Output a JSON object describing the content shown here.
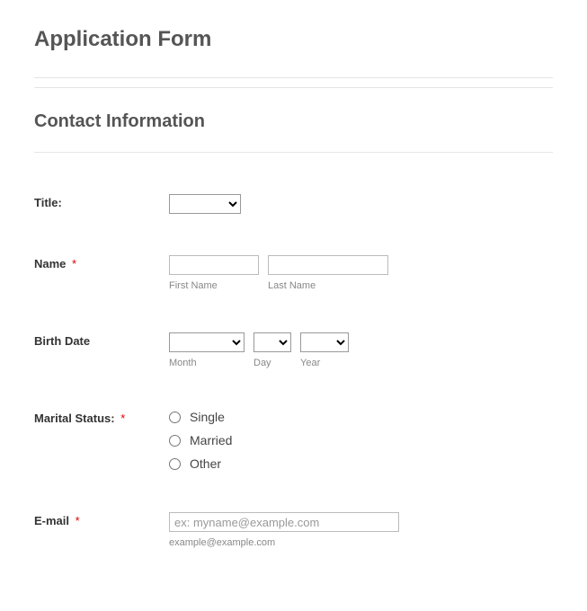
{
  "page_title": "Application Form",
  "section_title": "Contact Information",
  "required_mark": "*",
  "fields": {
    "title": {
      "label": "Title:"
    },
    "name": {
      "label": "Name",
      "first_sub": "First Name",
      "last_sub": "Last Name"
    },
    "birth_date": {
      "label": "Birth Date",
      "month_sub": "Month",
      "day_sub": "Day",
      "year_sub": "Year"
    },
    "marital_status": {
      "label": "Marital Status:",
      "options": {
        "single": "Single",
        "married": "Married",
        "other": "Other"
      }
    },
    "email": {
      "label": "E-mail",
      "placeholder": "ex: myname@example.com",
      "sub": "example@example.com"
    }
  }
}
